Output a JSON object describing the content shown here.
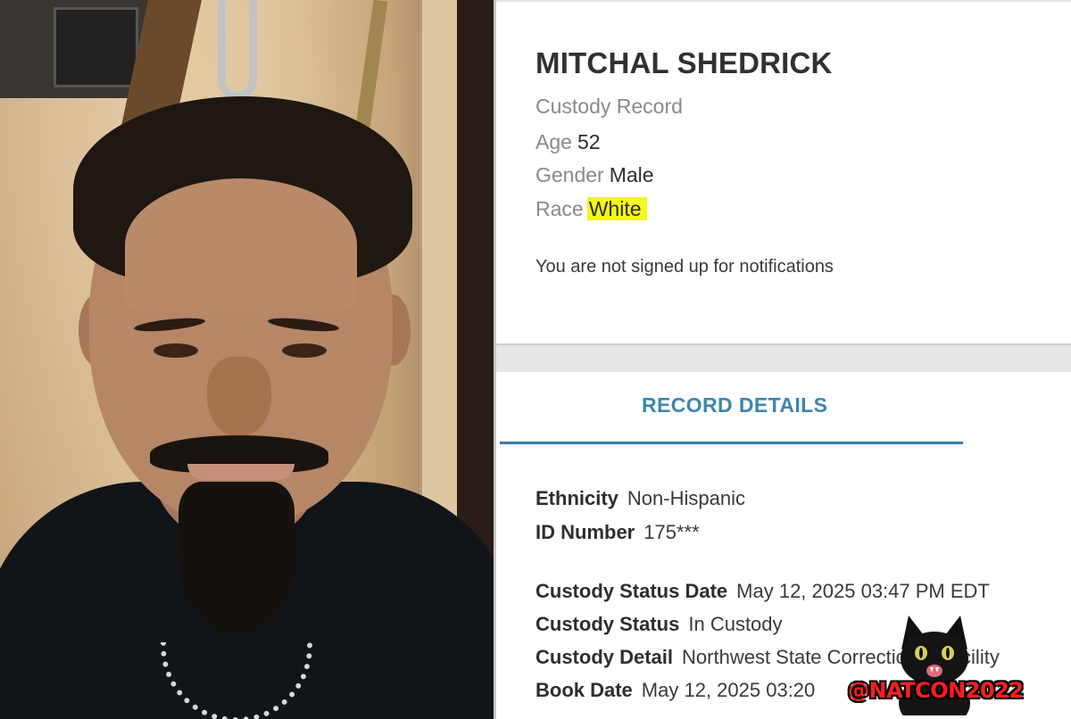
{
  "record": {
    "name": "MITCHAL SHEDRICK",
    "subtitle": "Custody Record",
    "age_label": "Age",
    "age_value": "52",
    "gender_label": "Gender",
    "gender_value": "Male",
    "race_label": "Race",
    "race_value": "White",
    "race_highlight_color": "#f4f71a",
    "notifications_text": "You are not signed up for notifications"
  },
  "tabs": {
    "record_details": "RECORD DETAILS",
    "accent_color": "#3e86ad"
  },
  "details": {
    "ethnicity_label": "Ethnicity",
    "ethnicity_value": "Non-Hispanic",
    "id_label": "ID Number",
    "id_value": "175***",
    "custody_status_date_label": "Custody Status Date",
    "custody_status_date_value": "May 12, 2025 03:47 PM EDT",
    "custody_status_label": "Custody Status",
    "custody_status_value": "In Custody",
    "custody_detail_label": "Custody Detail",
    "custody_detail_value": "Northwest State Correctional Facility",
    "book_date_label": "Book Date",
    "book_date_value": "May 12, 2025 03:20"
  },
  "watermark": {
    "handle": "@NATCON2022",
    "icon": "black-cat-icon",
    "color": "#ff1d1d"
  },
  "photo": {
    "icon": "person-selfie-photo"
  }
}
